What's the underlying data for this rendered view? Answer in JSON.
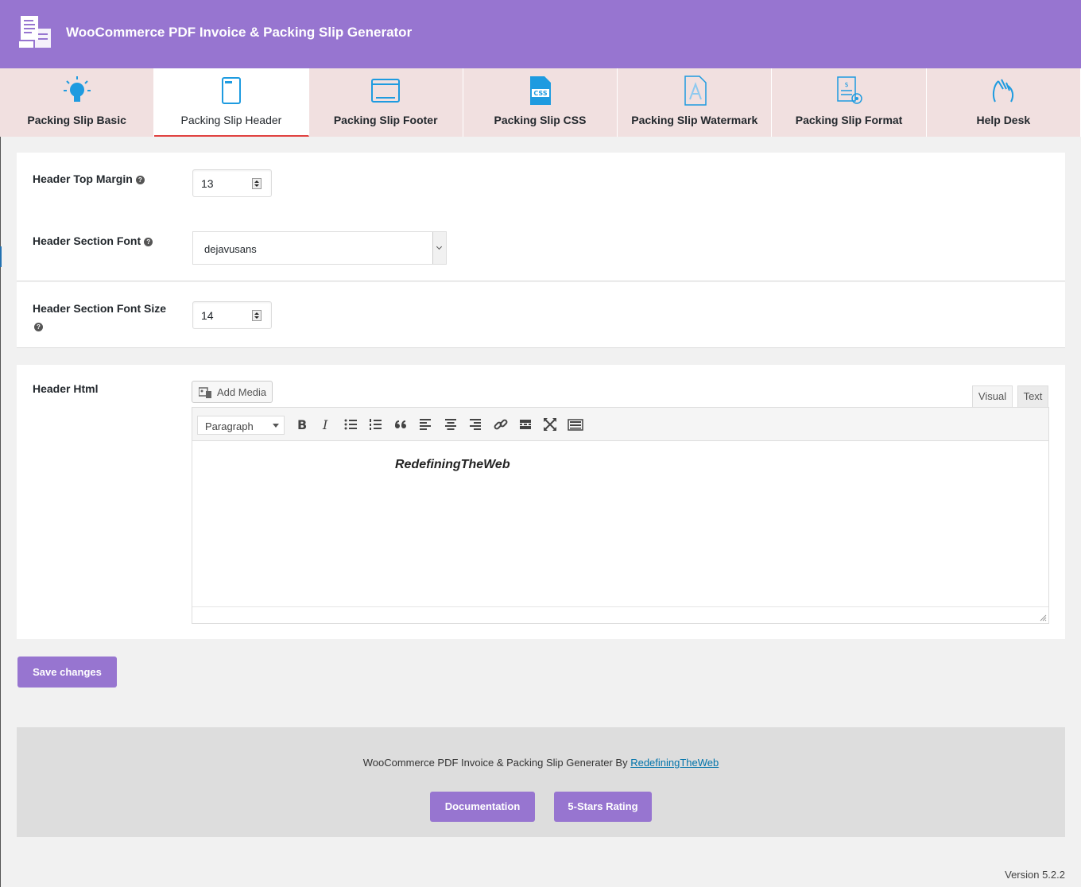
{
  "app": {
    "title": "WooCommerce PDF Invoice & Packing Slip Generator",
    "brand_color": "#9775d0",
    "active_tab_underline": "#e0413f"
  },
  "tabs": [
    {
      "label": "Packing Slip Basic",
      "icon": "lightbulb-icon",
      "active": false
    },
    {
      "label": "Packing Slip Header",
      "icon": "page-header-icon",
      "active": true
    },
    {
      "label": "Packing Slip Footer",
      "icon": "browser-window-icon",
      "active": false
    },
    {
      "label": "Packing Slip CSS",
      "icon": "css-file-icon",
      "active": false
    },
    {
      "label": "Packing Slip Watermark",
      "icon": "watermark-letter-icon",
      "active": false
    },
    {
      "label": "Packing Slip Format",
      "icon": "invoice-gear-icon",
      "active": false
    },
    {
      "label": "Help Desk",
      "icon": "helping-hands-icon",
      "active": false
    }
  ],
  "form": {
    "header_top_margin": {
      "label": "Header Top Margin",
      "value": "13"
    },
    "header_section_font": {
      "label": "Header Section Font",
      "value": "dejavusans"
    },
    "header_section_font_size": {
      "label": "Header Section Font Size",
      "value": "14"
    },
    "header_html": {
      "label": "Header Html",
      "add_media_label": "Add Media",
      "mode_visual": "Visual",
      "mode_text": "Text",
      "format_select": "Paragraph",
      "content": "RedefiningTheWeb"
    },
    "save_label": "Save changes"
  },
  "footer": {
    "text_prefix": "WooCommerce PDF Invoice & Packing Slip Generater By",
    "link_text": "RedefiningTheWeb",
    "documentation_label": "Documentation",
    "rating_label": "5-Stars Rating"
  },
  "version": "Version 5.2.2"
}
